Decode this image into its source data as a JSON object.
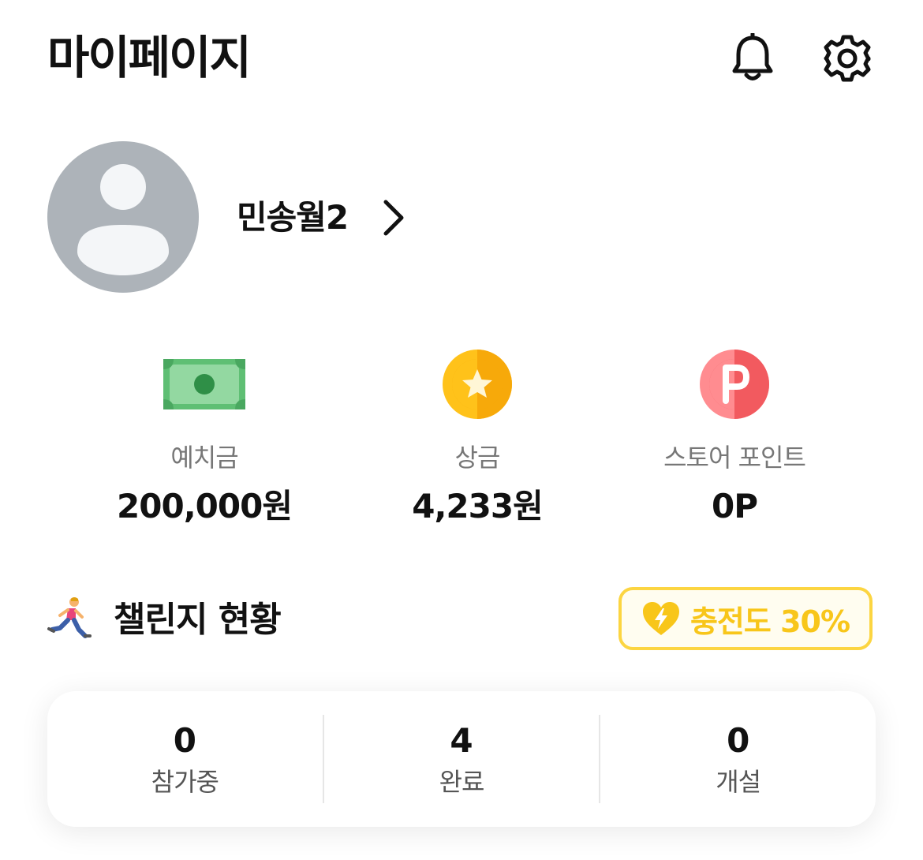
{
  "header": {
    "title": "마이페이지",
    "icons": [
      "bell-icon",
      "gear-icon"
    ]
  },
  "profile": {
    "name": "민송월2",
    "avatar_icon": "default-avatar-icon"
  },
  "stats": [
    {
      "icon": "money-bill-icon",
      "label": "예치금",
      "value": "200,000원"
    },
    {
      "icon": "star-coin-icon",
      "label": "상금",
      "value": "4,233원"
    },
    {
      "icon": "point-coin-icon",
      "label": "스토어 포인트",
      "value": "0P"
    }
  ],
  "challenge": {
    "emoji": "🏃",
    "title": "챌린지 현황",
    "charge_label": "충전도 30%",
    "summary": [
      {
        "count": "0",
        "label": "참가중"
      },
      {
        "count": "4",
        "label": "완료"
      },
      {
        "count": "0",
        "label": "개설"
      }
    ]
  },
  "colors": {
    "accent_yellow": "#f8c61a",
    "badge_border": "#fcd541",
    "avatar_gray": "#adb3b9",
    "money_green": "#5fbf74",
    "coin_gold": "#ffc21a",
    "point_red": "#f25a5f"
  }
}
